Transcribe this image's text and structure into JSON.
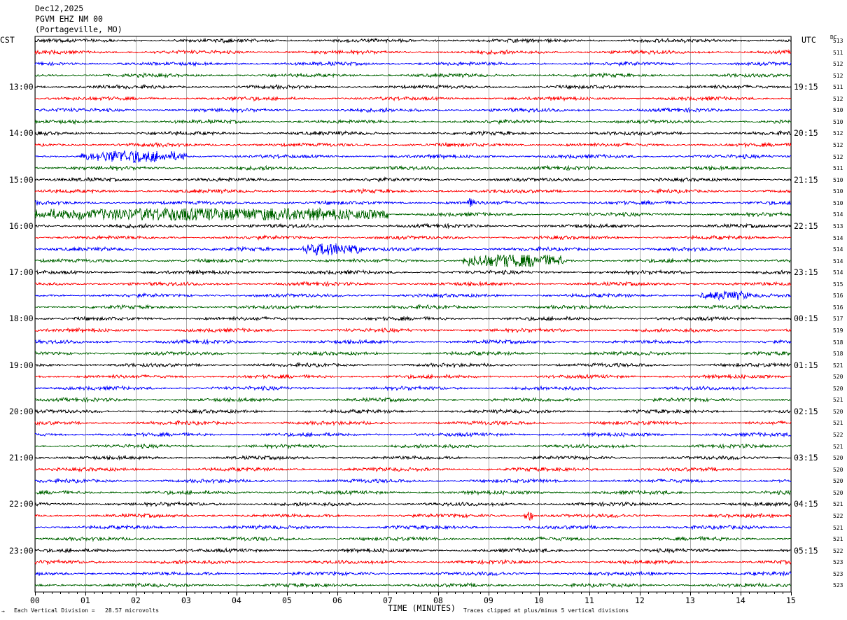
{
  "header": {
    "date": "Dec12,2025",
    "station": "PGVM EHZ NM 00",
    "location": "(Portageville, MO)"
  },
  "left_axis_label": "CST",
  "right_axis_label": "UTC",
  "dc_header": "DC",
  "footer": {
    "left_mark": "→",
    "scale_text": "Each Vertical Division =   28.57 microvolts",
    "xlabel": "TIME (MINUTES)",
    "clip_text": "Traces clipped at plus/minus 5 vertical divisions"
  },
  "colors": {
    "cycle": [
      "#000000",
      "#ff0000",
      "#0000ff",
      "#006400"
    ],
    "grid": "#000000"
  },
  "chart_data": {
    "type": "line",
    "title": "",
    "xlabel": "TIME (MINUTES)",
    "x_ticks": [
      "00",
      "01",
      "02",
      "03",
      "04",
      "05",
      "06",
      "07",
      "08",
      "09",
      "10",
      "11",
      "12",
      "13",
      "14",
      "15"
    ],
    "xlim": [
      0,
      15
    ],
    "left_hour_labels": [
      "13:00",
      "14:00",
      "15:00",
      "16:00",
      "17:00",
      "18:00",
      "19:00",
      "20:00",
      "21:00",
      "22:00",
      "23:00"
    ],
    "right_hour_labels": [
      "19:15",
      "20:15",
      "21:15",
      "22:15",
      "23:15",
      "00:15",
      "01:15",
      "02:15",
      "03:15",
      "04:15",
      "05:15"
    ],
    "first_hour_label_row": 4,
    "rows_per_hour": 4,
    "trace_count": 48,
    "dc_offsets": [
      "513",
      "511",
      "512",
      "512",
      "511",
      "512",
      "510",
      "510",
      "512",
      "512",
      "512",
      "511",
      "510",
      "510",
      "510",
      "514",
      "513",
      "514",
      "514",
      "514",
      "514",
      "515",
      "516",
      "516",
      "517",
      "519",
      "518",
      "518",
      "521",
      "520",
      "520",
      "521",
      "520",
      "521",
      "522",
      "521",
      "520",
      "520",
      "520",
      "520",
      "521",
      "522",
      "521",
      "521",
      "522",
      "523",
      "523",
      "523"
    ],
    "events": [
      {
        "row": 10,
        "start_min": 0.9,
        "end_min": 3.0,
        "amplitude": 2.2
      },
      {
        "row": 14,
        "start_min": 8.55,
        "end_min": 8.7,
        "amplitude": 3.0
      },
      {
        "row": 15,
        "start_min": 0.0,
        "end_min": 7.0,
        "amplitude": 2.8
      },
      {
        "row": 18,
        "start_min": 5.3,
        "end_min": 6.5,
        "amplitude": 2.6
      },
      {
        "row": 19,
        "start_min": 8.5,
        "end_min": 10.5,
        "amplitude": 3.0
      },
      {
        "row": 22,
        "start_min": 13.2,
        "end_min": 14.2,
        "amplitude": 1.4
      },
      {
        "row": 41,
        "start_min": 9.7,
        "end_min": 9.9,
        "amplitude": 1.8
      }
    ]
  }
}
